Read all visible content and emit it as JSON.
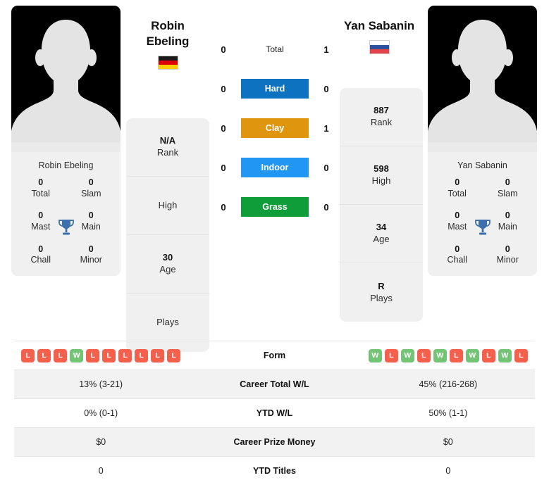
{
  "players": {
    "left": {
      "name": "Robin Ebeling",
      "name_line1": "Robin",
      "name_line2": "Ebeling",
      "card_name": "Robin Ebeling",
      "flag": "germany-flag",
      "photo": "player-photo-placeholder",
      "titles": [
        {
          "num": "0",
          "label": "Total"
        },
        {
          "num": "0",
          "label": "Slam"
        },
        {
          "num": "0",
          "label": "Mast"
        },
        {
          "num": "0",
          "label": "Main"
        },
        {
          "num": "0",
          "label": "Chall"
        },
        {
          "num": "0",
          "label": "Minor"
        }
      ],
      "info": [
        {
          "num": "N/A",
          "label": "Rank"
        },
        {
          "num": "",
          "label": "High"
        },
        {
          "num": "30",
          "label": "Age"
        },
        {
          "num": "",
          "label": "Plays"
        }
      ],
      "form": [
        "L",
        "L",
        "L",
        "W",
        "L",
        "L",
        "L",
        "L",
        "L",
        "L"
      ]
    },
    "right": {
      "name": "Yan Sabanin",
      "card_name": "Yan Sabanin",
      "flag": "russia-flag",
      "photo": "player-photo-placeholder",
      "titles": [
        {
          "num": "0",
          "label": "Total"
        },
        {
          "num": "0",
          "label": "Slam"
        },
        {
          "num": "0",
          "label": "Mast"
        },
        {
          "num": "0",
          "label": "Main"
        },
        {
          "num": "0",
          "label": "Chall"
        },
        {
          "num": "0",
          "label": "Minor"
        }
      ],
      "info": [
        {
          "num": "887",
          "label": "Rank"
        },
        {
          "num": "598",
          "label": "High"
        },
        {
          "num": "34",
          "label": "Age"
        },
        {
          "num": "R",
          "label": "Plays"
        }
      ],
      "form": [
        "W",
        "L",
        "W",
        "L",
        "W",
        "L",
        "W",
        "L",
        "W",
        "L"
      ]
    }
  },
  "head_to_head": [
    {
      "left": "0",
      "label": "Total",
      "right": "1",
      "surface": false,
      "color": ""
    },
    {
      "left": "0",
      "label": "Hard",
      "right": "0",
      "surface": true,
      "color": "#0d72bf"
    },
    {
      "left": "0",
      "label": "Clay",
      "right": "1",
      "surface": true,
      "color": "#e0950f"
    },
    {
      "left": "0",
      "label": "Indoor",
      "right": "0",
      "surface": true,
      "color": "#2196f3"
    },
    {
      "left": "0",
      "label": "Grass",
      "right": "0",
      "surface": true,
      "color": "#0f9d3a"
    }
  ],
  "stats_rows": [
    {
      "label": "Form",
      "left": "",
      "right": "",
      "type": "form"
    },
    {
      "label": "Career Total W/L",
      "left": "13% (3-21)",
      "right": "45% (216-268)",
      "type": "text"
    },
    {
      "label": "YTD W/L",
      "left": "0% (0-1)",
      "right": "50% (1-1)",
      "type": "text"
    },
    {
      "label": "Career Prize Money",
      "left": "$0",
      "right": "$0",
      "type": "text"
    },
    {
      "label": "YTD Titles",
      "left": "0",
      "right": "0",
      "type": "text"
    }
  ],
  "colors": {
    "win": "#74c476",
    "loss": "#f4604b",
    "trophy": "#3d6fad",
    "card_bg": "#f0f0f0"
  }
}
